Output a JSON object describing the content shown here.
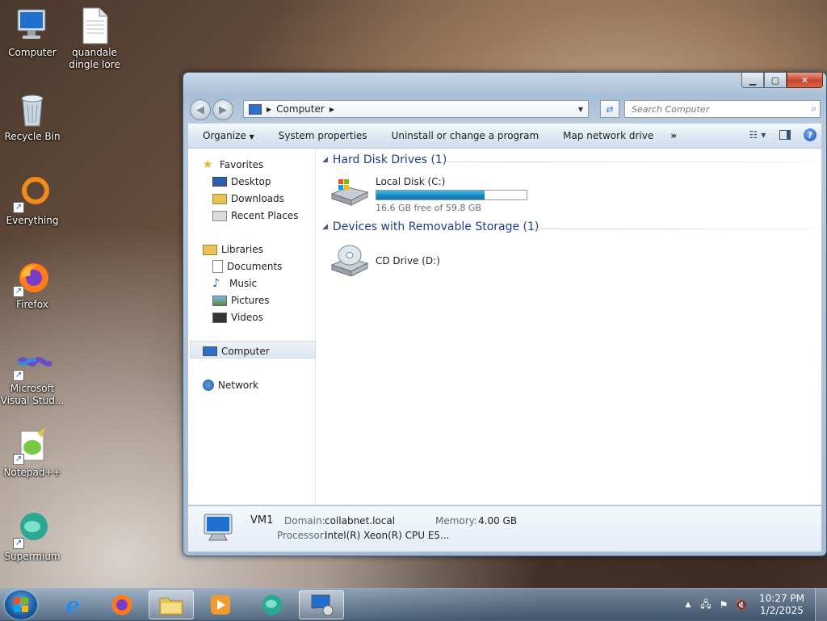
{
  "desktop": {
    "icons": [
      {
        "label": "Computer"
      },
      {
        "label": "quandale dingle lore"
      },
      {
        "label": "Recycle Bin"
      },
      {
        "label": "Everything"
      },
      {
        "label": "Firefox"
      },
      {
        "label": "Microsoft Visual Stud..."
      },
      {
        "label": "Notepad++"
      },
      {
        "label": "Supermium"
      }
    ]
  },
  "window": {
    "address": {
      "crumb": "Computer"
    },
    "search": {
      "placeholder": "Search Computer"
    },
    "commands": [
      "Organize",
      "System properties",
      "Uninstall or change a program",
      "Map network drive",
      "»"
    ],
    "nav": {
      "favorites": "Favorites",
      "desktop": "Desktop",
      "downloads": "Downloads",
      "recent": "Recent Places",
      "libraries": "Libraries",
      "documents": "Documents",
      "music": "Music",
      "pictures": "Pictures",
      "videos": "Videos",
      "computer": "Computer",
      "network": "Network"
    },
    "groups": {
      "hdd": "Hard Disk Drives (1)",
      "removable": "Devices with Removable Storage (1)"
    },
    "drives": {
      "local": {
        "label": "Local Disk (C:)",
        "free_text": "16.6 GB free of 59.8 GB",
        "used_fraction": 0.72
      },
      "cd": {
        "label": "CD Drive (D:)"
      }
    },
    "details": {
      "name": "VM1",
      "domain_label": "Domain:",
      "domain": "collabnet.local",
      "memory_label": "Memory:",
      "memory": "4.00 GB",
      "processor_label": "Processor:",
      "processor": "Intel(R) Xeon(R) CPU E5..."
    }
  },
  "taskbar": {
    "time": "10:27 PM",
    "date": "1/2/2025"
  }
}
